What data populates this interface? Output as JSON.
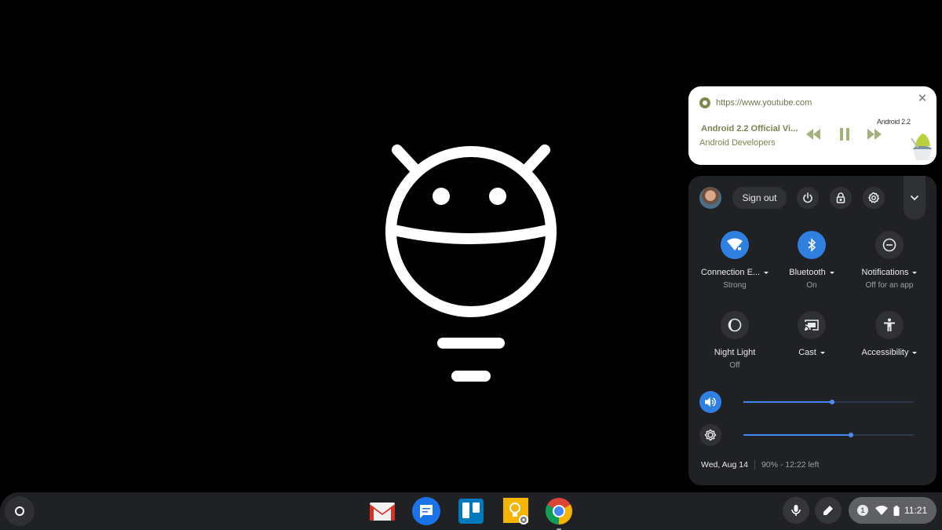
{
  "media_notification": {
    "origin": "https://www.youtube.com",
    "title": "Android 2.2 Official Vi...",
    "artist": "Android Developers",
    "artwork_caption": "Android 2.2",
    "icons": {
      "source": "chrome-icon",
      "close": "close-icon",
      "previous": "rewind-icon",
      "play_pause": "pause-icon",
      "next": "fast-forward-icon"
    },
    "close_glyph": "✕"
  },
  "system_tray": {
    "top_row": {
      "sign_out_label": "Sign out",
      "buttons": [
        "power-icon",
        "lock-icon",
        "settings-gear-icon",
        "collapse-chevron-icon"
      ]
    },
    "feature_pods": [
      {
        "label": "Connection E...",
        "sublabel": "Strong",
        "icon": "wifi-lock-icon",
        "active": true,
        "has_menu": true
      },
      {
        "label": "Bluetooth",
        "sublabel": "On",
        "icon": "bluetooth-icon",
        "active": true,
        "has_menu": true
      },
      {
        "label": "Notifications",
        "sublabel": "Off for an app",
        "icon": "do-not-disturb-icon",
        "active": false,
        "has_menu": true
      },
      {
        "label": "Night Light",
        "sublabel": "Off",
        "icon": "night-light-icon",
        "active": false,
        "has_menu": false
      },
      {
        "label": "Cast",
        "sublabel": "",
        "icon": "cast-icon",
        "active": false,
        "has_menu": true
      },
      {
        "label": "Accessibility",
        "sublabel": "",
        "icon": "accessibility-icon",
        "active": false,
        "has_menu": true
      }
    ],
    "sliders": {
      "volume_percent": 52,
      "brightness_percent": 63
    },
    "date": "Wed, Aug 14",
    "battery_status": "90% - 12:22 left"
  },
  "shelf": {
    "launcher_icon": "launcher-icon",
    "apps": [
      {
        "name": "Gmail",
        "icon": "gmail-icon"
      },
      {
        "name": "Messages",
        "icon": "messages-icon"
      },
      {
        "name": "Trello",
        "icon": "trello-icon"
      },
      {
        "name": "Google Keep",
        "icon": "keep-icon"
      },
      {
        "name": "Chrome",
        "icon": "chrome-icon",
        "running": true
      }
    ],
    "status_area": {
      "notification_count": "1",
      "time": "11:21"
    }
  },
  "colors": {
    "accent_blue": "#2f80e0",
    "tray_background": "#202124",
    "button_background": "#303134",
    "media_text": "#7a8450"
  }
}
